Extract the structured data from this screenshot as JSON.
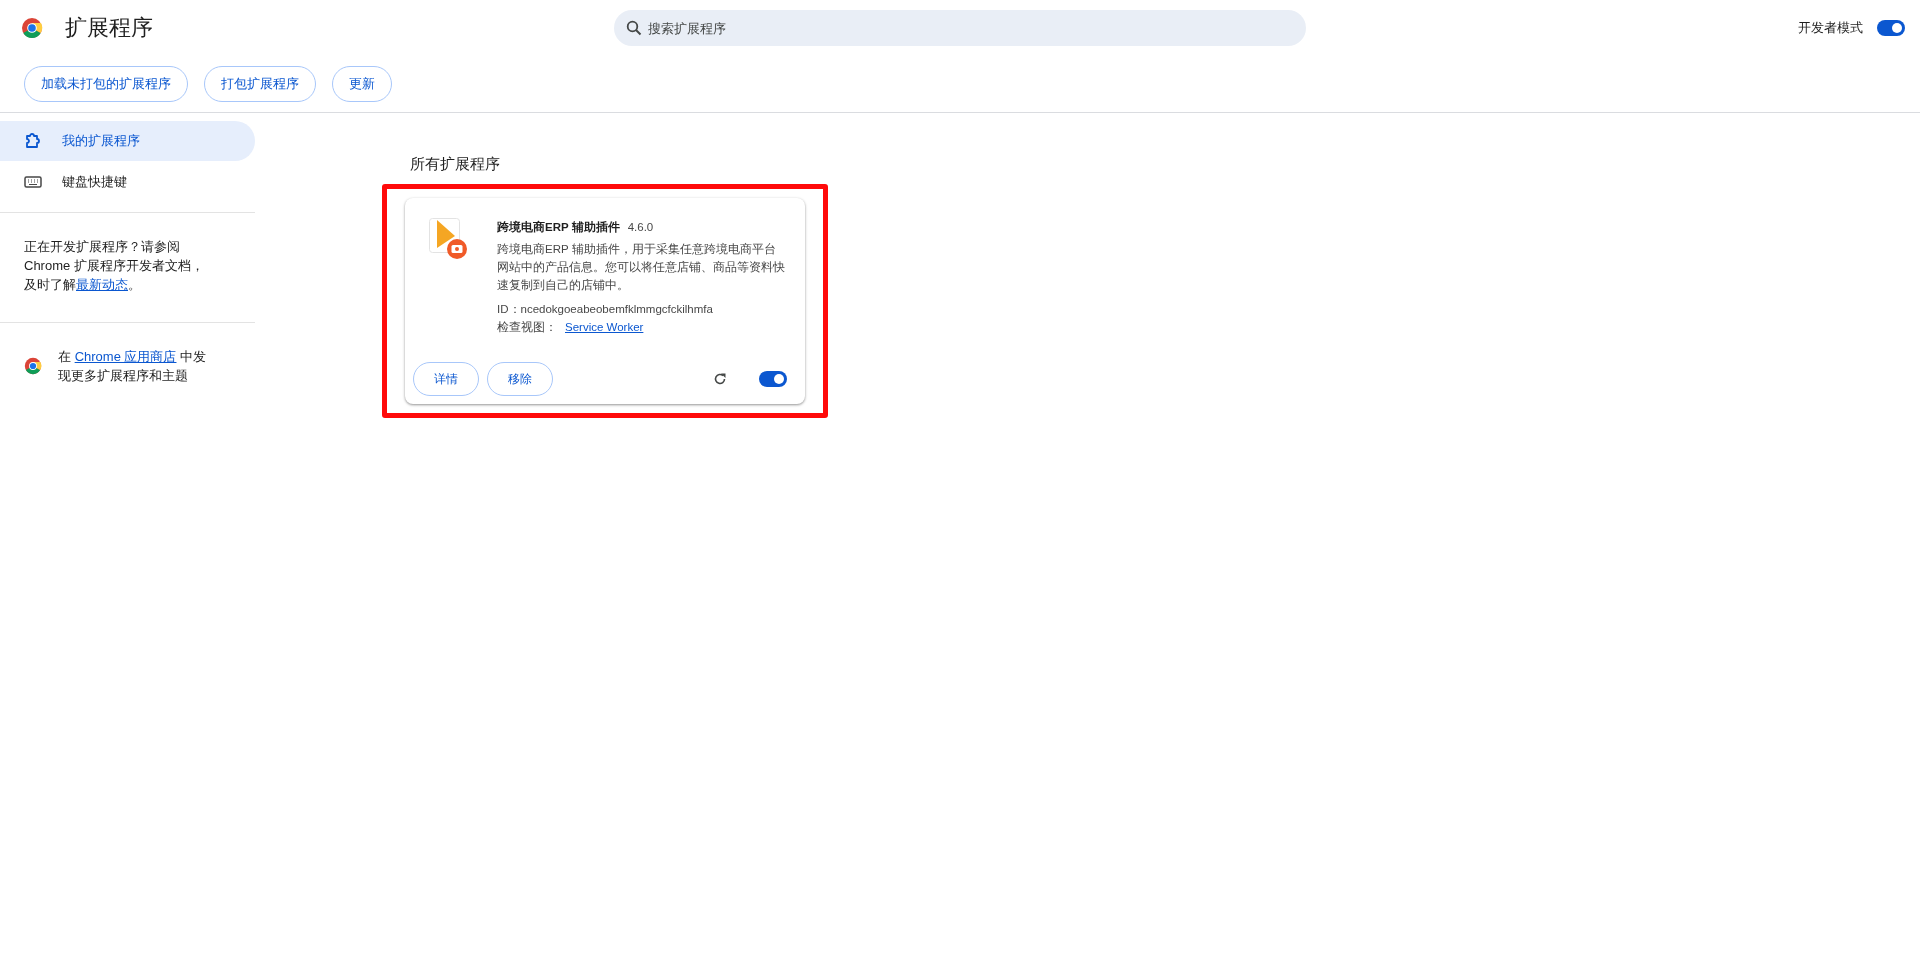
{
  "header": {
    "title": "扩展程序",
    "search": {
      "placeholder": "搜索扩展程序"
    },
    "developer_mode": {
      "label": "开发者模式",
      "on": true
    }
  },
  "toolbar": {
    "buttons": [
      "加载未打包的扩展程序",
      "打包扩展程序",
      "更新"
    ]
  },
  "sidebar": {
    "items": [
      {
        "label": "我的扩展程序",
        "kind": "puzzle",
        "selected": true
      },
      {
        "label": "键盘快捷键",
        "kind": "keyboard",
        "selected": false
      }
    ],
    "dev_note": {
      "text": "正在开发扩展程序？请参阅 Chrome 扩展程序开发者文档，及时了解",
      "link": "最新动态",
      "tail": "。"
    },
    "store_note": {
      "before": "在 ",
      "link": "Chrome 应用商店",
      "after": " 中发现更多扩展程序和主题"
    }
  },
  "main": {
    "heading": "所有扩展程序",
    "extensions": [
      {
        "name": "跨境电商ERP 辅助插件",
        "version": "4.6.0",
        "description": "跨境电商ERP 辅助插件，用于采集任意跨境电商平台网站中的产品信息。您可以将任意店铺、商品等资料快速复制到自己的店铺中。",
        "id_label": "ID：",
        "id": "ncedokgoeabeobemfklmmgcfckilhmfa",
        "inspect_label": "检查视图：",
        "inspect_link": "Service Worker",
        "buttons": [
          "详情",
          "移除"
        ],
        "enabled": true,
        "highlighted": true
      }
    ]
  }
}
